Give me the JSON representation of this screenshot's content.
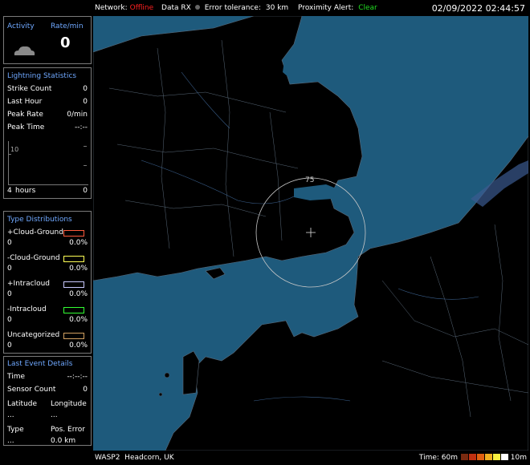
{
  "topbar": {
    "network_label": "Network:",
    "network_status": "Offline",
    "network_color": "#ff2020",
    "data_rx": "Data RX",
    "error_label": "Error tolerance:",
    "error_value": "30 km",
    "proximity_label": "Proximity Alert:",
    "proximity_status": "Clear",
    "proximity_color": "#22dd22",
    "datetime": "02/09/2022 02:44:57"
  },
  "activity": {
    "title": "Activity",
    "rate_title": "Rate/min",
    "rate_value": "0",
    "icon": "cloud-icon"
  },
  "stats": {
    "title": "Lightning Statistics",
    "rows": [
      {
        "label": "Strike Count",
        "value": "0"
      },
      {
        "label": "Last Hour",
        "value": "0"
      },
      {
        "label": "Peak Rate",
        "value": "0/min"
      },
      {
        "label": "Peak Time",
        "value": "--:--"
      }
    ],
    "graph_max": "10",
    "graph_start": "4",
    "graph_unit": "hours",
    "graph_end": "0"
  },
  "types": {
    "title": "Type Distributions",
    "items": [
      {
        "label": "+Cloud-Ground",
        "count": "0",
        "percent": "0.0%",
        "color": "#ff5a3c"
      },
      {
        "label": "-Cloud-Ground",
        "count": "0",
        "percent": "0.0%",
        "color": "#ffff55"
      },
      {
        "label": "+Intracloud",
        "count": "0",
        "percent": "0.0%",
        "color": "#c8c8ff"
      },
      {
        "label": "-Intracloud",
        "count": "0",
        "percent": "0.0%",
        "color": "#33ff33"
      },
      {
        "label": "Uncategorized",
        "count": "0",
        "percent": "0.0%",
        "color": "#d2a060"
      }
    ]
  },
  "last_event": {
    "title": "Last Event Details",
    "time_label": "Time",
    "time_value": "--:--:--",
    "sensor_label": "Sensor Count",
    "sensor_value": "0",
    "lat_label": "Latitude",
    "lon_label": "Longitude",
    "lat_value": "...",
    "lon_value": "...",
    "type_label": "Type",
    "pos_label": "Pos. Error",
    "type_value": "...",
    "pos_value": "0.0 km"
  },
  "map": {
    "range_label": "75",
    "sea_color": "#1e5a7c",
    "land_color": "#000000"
  },
  "bottombar": {
    "station_id": "WASP2",
    "station_name": "Headcorn, UK",
    "time_label": "Time: 60m",
    "time_end": "10m",
    "legend_colors": [
      "#7a2a10",
      "#c03010",
      "#e06010",
      "#f0b020",
      "#f8f040",
      "#ffffff"
    ]
  }
}
